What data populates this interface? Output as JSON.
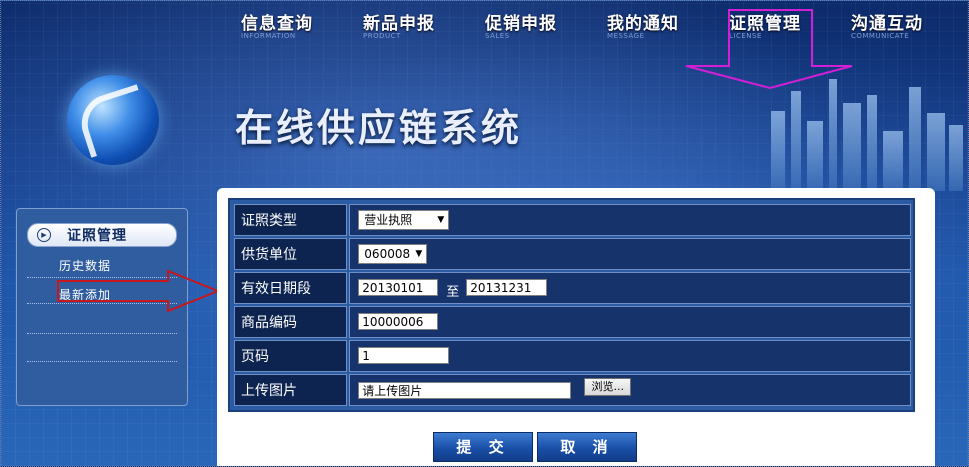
{
  "nav": [
    {
      "cn": "信息查询",
      "en": "INFORMATION"
    },
    {
      "cn": "新品申报",
      "en": "PRODUCT"
    },
    {
      "cn": "促销申报",
      "en": "SALES"
    },
    {
      "cn": "我的通知",
      "en": "MESSAGE"
    },
    {
      "cn": "证照管理",
      "en": "LICENSE"
    },
    {
      "cn": "沟通互动",
      "en": "COMMUNICATE"
    }
  ],
  "banner": {
    "title": "在线供应链系统"
  },
  "sidebar": {
    "head": "证照管理",
    "items": [
      "历史数据",
      "最新添加"
    ]
  },
  "form": {
    "license_type": {
      "label": "证照类型",
      "value": "营业执照"
    },
    "supplier": {
      "label": "供货单位",
      "value": "060008"
    },
    "date_range": {
      "label": "有效日期段",
      "start": "20130101",
      "to": "至",
      "end": "20131231"
    },
    "product_code": {
      "label": "商品编码",
      "value": "10000006"
    },
    "page": {
      "label": "页码",
      "value": "1"
    },
    "upload": {
      "label": "上传图片",
      "value": "请上传图片",
      "browse": "浏览..."
    }
  },
  "buttons": {
    "submit": "提 交",
    "cancel": "取 消"
  },
  "colors": {
    "annotation_magenta": "#d21fd6",
    "annotation_red": "#c8161d",
    "header_blue": "#0d2b6b"
  }
}
